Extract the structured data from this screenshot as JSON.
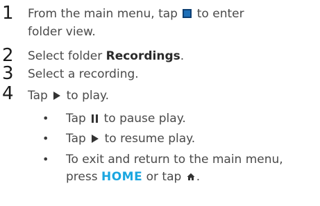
{
  "steps": [
    {
      "number": "1",
      "line1_before": "From the main menu, tap",
      "line1_icon": "folder-view-icon",
      "line1_after": "to enter",
      "line2": "folder view."
    },
    {
      "number": "2",
      "text_before": "Select folder",
      "text_bold": "Recordings",
      "text_after": "."
    },
    {
      "number": "3",
      "text": "Select a recording."
    },
    {
      "number": "4",
      "text_before": "Tap",
      "text_icon": "play-icon",
      "text_after": "to play.",
      "bullets": [
        {
          "before": "Tap",
          "icon": "pause-icon",
          "after": "to pause play."
        },
        {
          "before": "Tap",
          "icon": "play-icon",
          "after": "to resume play."
        },
        {
          "line1": "To exit and return to the main menu,",
          "line2_before": "press",
          "line2_key": "HOME",
          "line2_middle": "or tap",
          "line2_icon": "home-icon",
          "line2_after": "."
        }
      ]
    }
  ],
  "colors": {
    "accent": "#1aa6e0",
    "folder_icon": "#1d6fb8",
    "text": "#4a4a4a",
    "number": "#1a1a1a"
  }
}
